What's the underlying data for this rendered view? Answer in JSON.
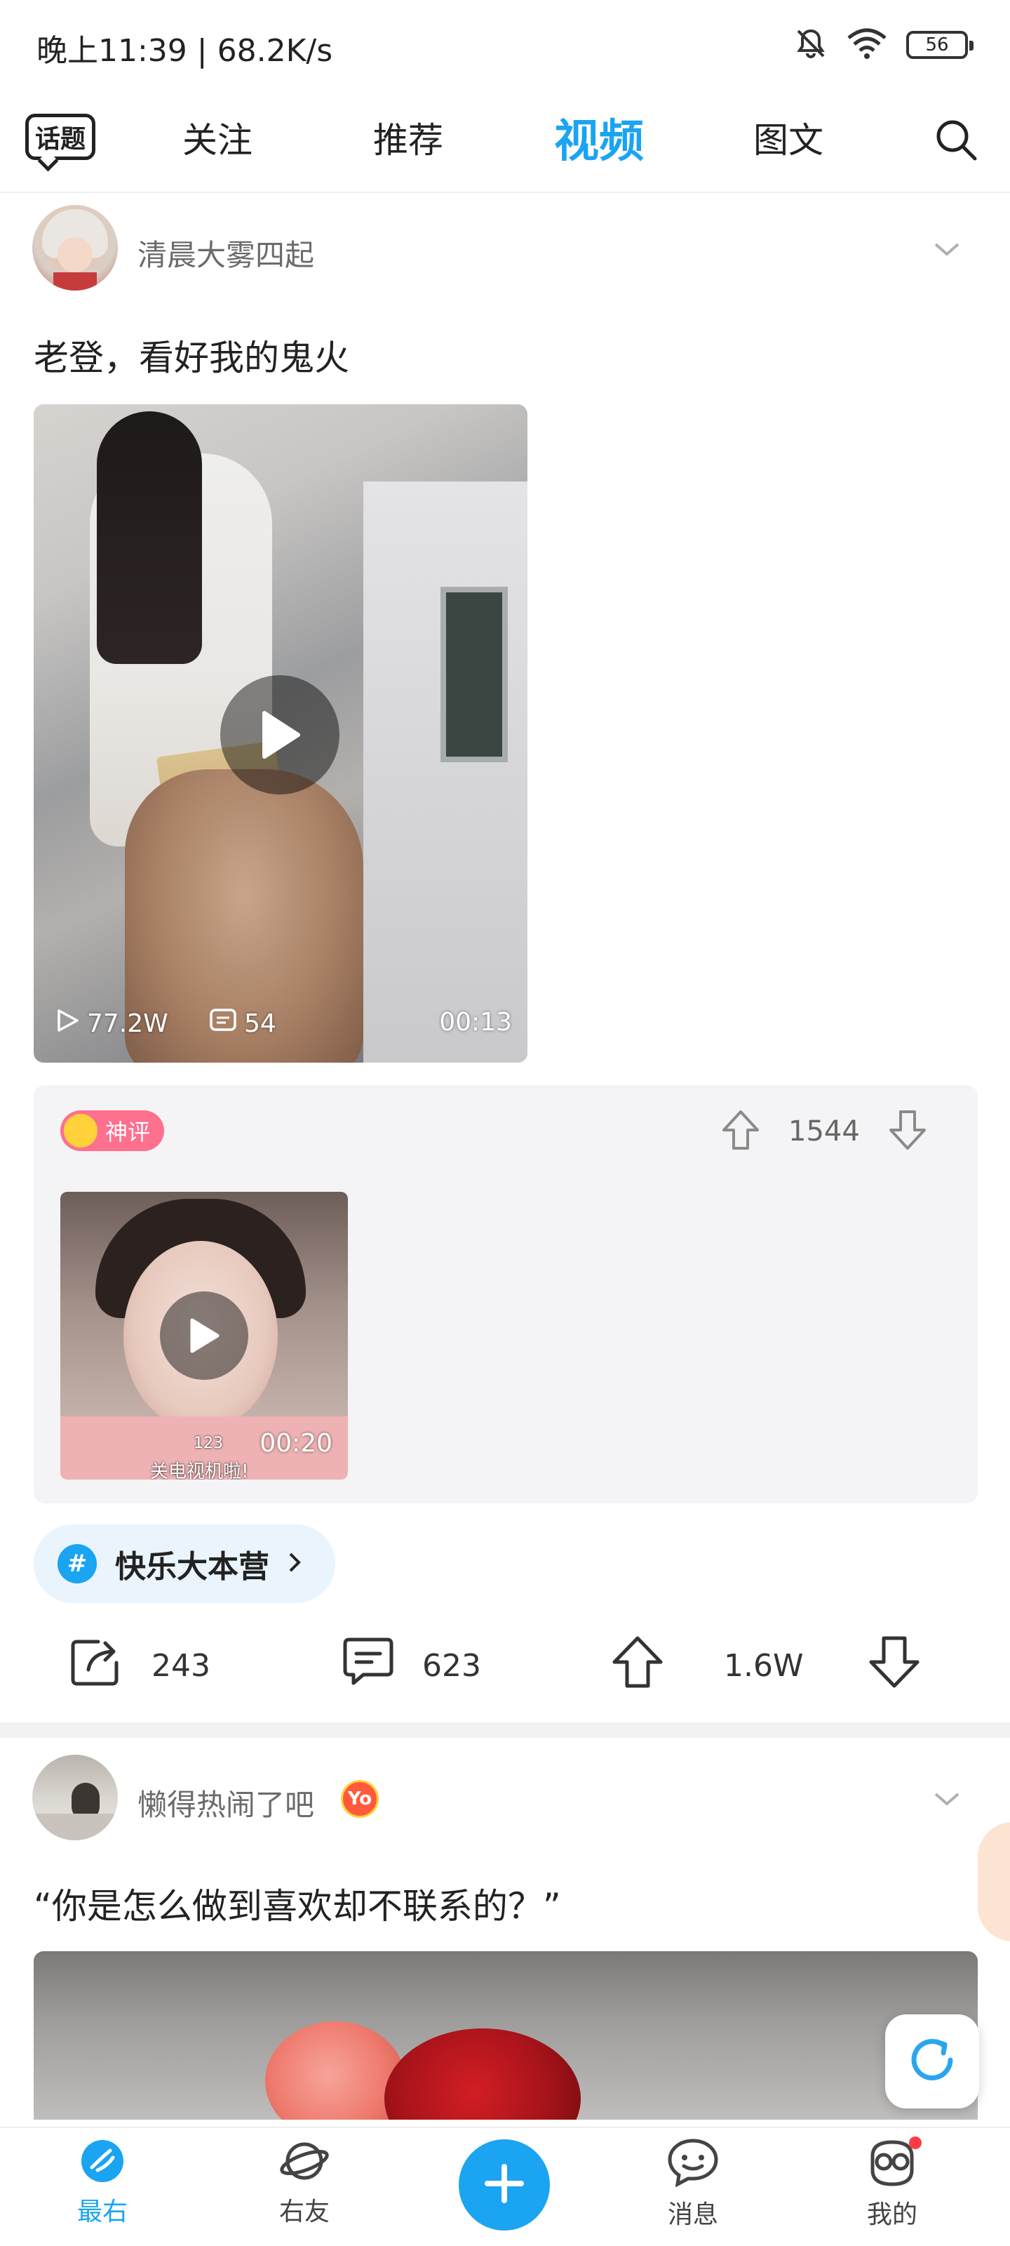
{
  "status_bar": {
    "time_speed": "晚上11:39 | 68.2K/s",
    "battery": "56"
  },
  "tabs": {
    "topic": "话题",
    "items": [
      "关注",
      "推荐",
      "视频",
      "图文"
    ],
    "active": "视频"
  },
  "post1": {
    "username": "清晨大雾四起",
    "title": "老登，看好我的鬼火",
    "video": {
      "plays": "77.2W",
      "comments": "54",
      "duration": "00:13"
    },
    "top_comment": {
      "badge": "神评",
      "votes": "1544",
      "video_duration": "00:20",
      "video_caption_line1": "123",
      "video_caption_line2": "关电视机啦!"
    },
    "hashtag": "快乐大本营",
    "actions": {
      "share": "243",
      "comment": "623",
      "like": "1.6W"
    }
  },
  "post2": {
    "username": "懒得热闹了吧",
    "badge": "Yo",
    "title": "“你是怎么做到喜欢却不联系的？”"
  },
  "bottom_nav": {
    "items": [
      "最右",
      "右友",
      "消息",
      "我的"
    ],
    "active": "最右"
  },
  "colors": {
    "accent": "#1aa4f2",
    "badge_pink": "#ff6f8e"
  }
}
